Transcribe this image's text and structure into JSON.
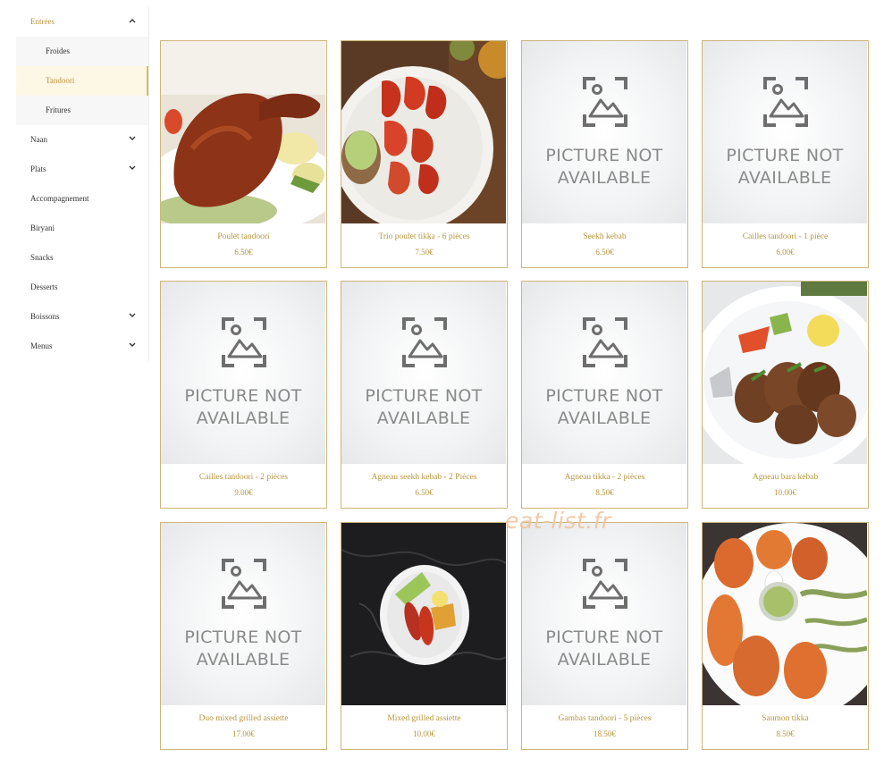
{
  "sidebar": {
    "items": [
      {
        "label": "Entrées",
        "chevron": "up"
      },
      {
        "label": "Froides",
        "sub": true
      },
      {
        "label": "Tandoori",
        "sub": true,
        "selected": true
      },
      {
        "label": "Fritures",
        "sub": true
      },
      {
        "label": "Naan",
        "chevron": "down"
      },
      {
        "label": "Plats",
        "chevron": "down"
      },
      {
        "label": "Accompagnement"
      },
      {
        "label": "Biryani"
      },
      {
        "label": "Snacks"
      },
      {
        "label": "Desserts"
      },
      {
        "label": "Boissons",
        "chevron": "down"
      },
      {
        "label": "Menus",
        "chevron": "down"
      }
    ]
  },
  "products": [
    {
      "name": "Poulet tandoori",
      "price": "6.50€",
      "image": "roast-chicken-leg"
    },
    {
      "name": "Trio poulet tikka - 6 pièces",
      "price": "7.50€",
      "image": "chicken-tikka-plate"
    },
    {
      "name": "Seekh kebab",
      "price": "6.50€",
      "image": "placeholder"
    },
    {
      "name": "Cailles tandoori - 1 pièce",
      "price": "6.00€",
      "image": "placeholder"
    },
    {
      "name": "Cailles tandoori - 2 pièces",
      "price": "9.00€",
      "image": "placeholder"
    },
    {
      "name": "Agneau seekh kebab - 2 Pièces",
      "price": "6.50€",
      "image": "placeholder"
    },
    {
      "name": "Agneau tikka - 2 pièces",
      "price": "8.50€",
      "image": "placeholder"
    },
    {
      "name": "Agneau bara kebab",
      "price": "10.00€",
      "image": "lamb-kebab-plate"
    },
    {
      "name": "Duo mixed grilled assiette",
      "price": "17.00€",
      "image": "placeholder"
    },
    {
      "name": "Mixed grilled assiette",
      "price": "10.00€",
      "image": "mixed-grill-on-marble"
    },
    {
      "name": "Gambas tandoori - 5 pièces",
      "price": "18.50€",
      "image": "placeholder"
    },
    {
      "name": "Saumon tikka",
      "price": "8.50€",
      "image": "salmon-tikka-plate"
    }
  ],
  "placeholder": {
    "line1": "PICTURE NOT",
    "line2": "AVAILABLE",
    "icon": "image-placeholder-icon"
  },
  "watermark": "eat-list.fr",
  "colors": {
    "accent": "#b8963f",
    "card_border": "#cdb67a",
    "selected_bg": "#fdf8e6"
  }
}
